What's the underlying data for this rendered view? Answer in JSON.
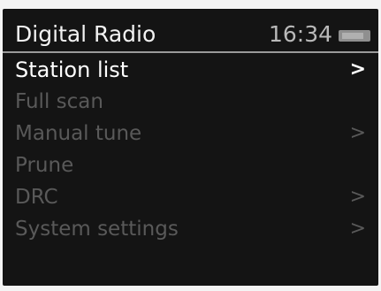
{
  "header": {
    "title": "Digital Radio",
    "time": "16:34",
    "battery_icon": "battery-icon"
  },
  "menu": {
    "items": [
      {
        "label": "Station list",
        "arrow": ">",
        "selected": true
      },
      {
        "label": "Full scan",
        "arrow": ""
      },
      {
        "label": "Manual tune",
        "arrow": ">"
      },
      {
        "label": "Prune",
        "arrow": ""
      },
      {
        "label": "DRC",
        "arrow": ">"
      },
      {
        "label": "System settings",
        "arrow": ">"
      }
    ]
  },
  "colors": {
    "screen_background": "#141414",
    "selected_text": "#ffffff",
    "dimmed_text": "#595959",
    "header_divider": "#9a9a9a"
  }
}
